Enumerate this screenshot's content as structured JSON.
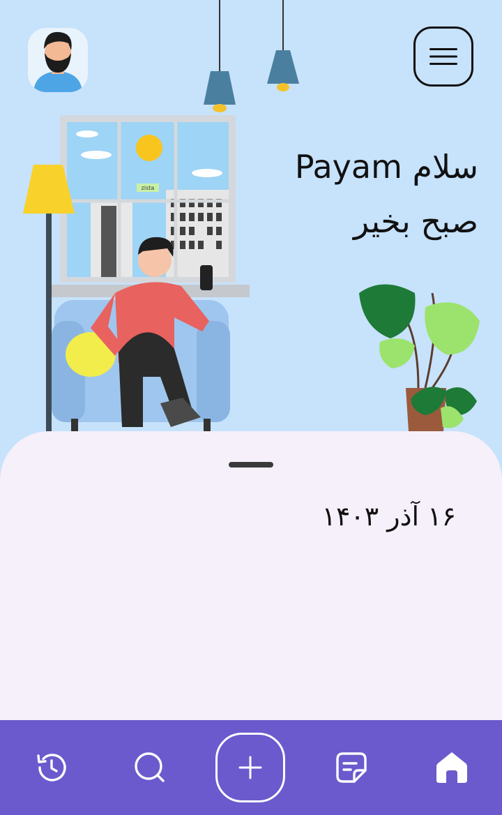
{
  "header": {
    "greeting_line1": "سلام Payam",
    "greeting_line2": "صبح بخیر",
    "menu_icon": "hamburger-icon",
    "avatar_icon": "user-avatar"
  },
  "illustration": {
    "sign_text": "zista"
  },
  "sheet": {
    "date": "۱۶ آذر ۱۴۰۳"
  },
  "bottom_nav": {
    "background": "#6a5acd",
    "items": [
      {
        "icon": "history-icon"
      },
      {
        "icon": "search-icon"
      },
      {
        "icon": "add-icon"
      },
      {
        "icon": "notes-icon"
      },
      {
        "icon": "home-icon",
        "active": true
      }
    ]
  }
}
